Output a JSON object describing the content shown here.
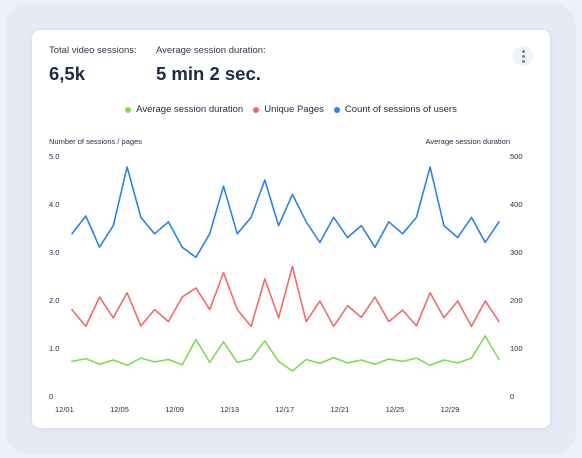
{
  "metrics": {
    "sessions_label": "Total video sessions:",
    "sessions_value": "6,5k",
    "duration_label": "Average session duration:",
    "duration_value": "5 min 2 sec."
  },
  "menu_icon": "more-vertical-icon",
  "colors": {
    "green": "#7ed957",
    "red": "#f06a6a",
    "blue": "#2f80e8"
  },
  "chart_data": {
    "type": "line",
    "left_axis_label": "Number of sessions / pages",
    "right_axis_label": "Average session duration",
    "x_ticks": [
      "12/01",
      "12/05",
      "12/09",
      "12/13",
      "12/17",
      "12/21",
      "12/25",
      "12/29"
    ],
    "left_yticks": [
      "5.0",
      "4.0",
      "3.0",
      "2.0",
      "1.0",
      "0"
    ],
    "right_yticks": [
      "500",
      "400",
      "300",
      "200",
      "100",
      "0"
    ],
    "ylim_left": [
      0,
      5
    ],
    "ylim_right": [
      0,
      500
    ],
    "x_start": "12/01",
    "x_end": "01/02",
    "grid": false,
    "legend_position": "top",
    "series": [
      {
        "name": "Average session duration",
        "color": "#7ed957",
        "values": [
          0.72,
          0.78,
          0.66,
          0.75,
          0.64,
          0.79,
          0.71,
          0.76,
          0.65,
          1.18,
          0.7,
          1.13,
          0.7,
          0.77,
          1.15,
          0.72,
          0.52,
          0.76,
          0.68,
          0.8,
          0.69,
          0.75,
          0.66,
          0.77,
          0.72,
          0.79,
          0.64,
          0.75,
          0.69,
          0.79,
          1.25,
          0.76
        ]
      },
      {
        "name": "Unique Pages",
        "color": "#f06a6a",
        "values": [
          1.8,
          1.45,
          2.06,
          1.63,
          2.15,
          1.46,
          1.8,
          1.55,
          2.06,
          2.25,
          1.8,
          2.57,
          1.8,
          1.45,
          2.44,
          1.63,
          2.7,
          1.55,
          1.98,
          1.45,
          1.88,
          1.64,
          2.06,
          1.55,
          1.79,
          1.46,
          2.15,
          1.63,
          1.98,
          1.45,
          1.98,
          1.55
        ]
      },
      {
        "name": "Count of sessions of users",
        "color": "#2f80e8",
        "values": [
          3.38,
          3.75,
          3.1,
          3.55,
          4.77,
          3.72,
          3.38,
          3.63,
          3.1,
          2.89,
          3.38,
          4.37,
          3.38,
          3.72,
          4.5,
          3.55,
          4.2,
          3.63,
          3.2,
          3.72,
          3.3,
          3.55,
          3.1,
          3.63,
          3.38,
          3.72,
          4.77,
          3.55,
          3.3,
          3.72,
          3.2,
          3.63
        ]
      }
    ]
  }
}
